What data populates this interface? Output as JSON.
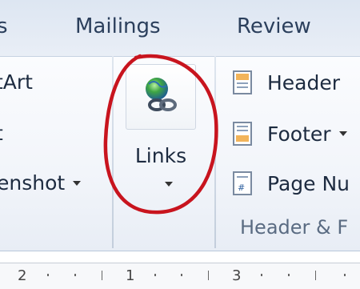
{
  "tabs": [
    "s",
    "Mailings",
    "Review"
  ],
  "left_group": {
    "items": [
      "tArt",
      "t",
      "enshot"
    ]
  },
  "links": {
    "label": "Links",
    "icon": "hyperlink-globe-icon"
  },
  "header_footer": {
    "items": [
      "Header",
      "Footer",
      "Page Nu"
    ],
    "group_label": "Header & F"
  },
  "ruler": {
    "numbers": [
      "2",
      "1",
      "3"
    ]
  },
  "annotation": {
    "color": "#c8141e"
  }
}
